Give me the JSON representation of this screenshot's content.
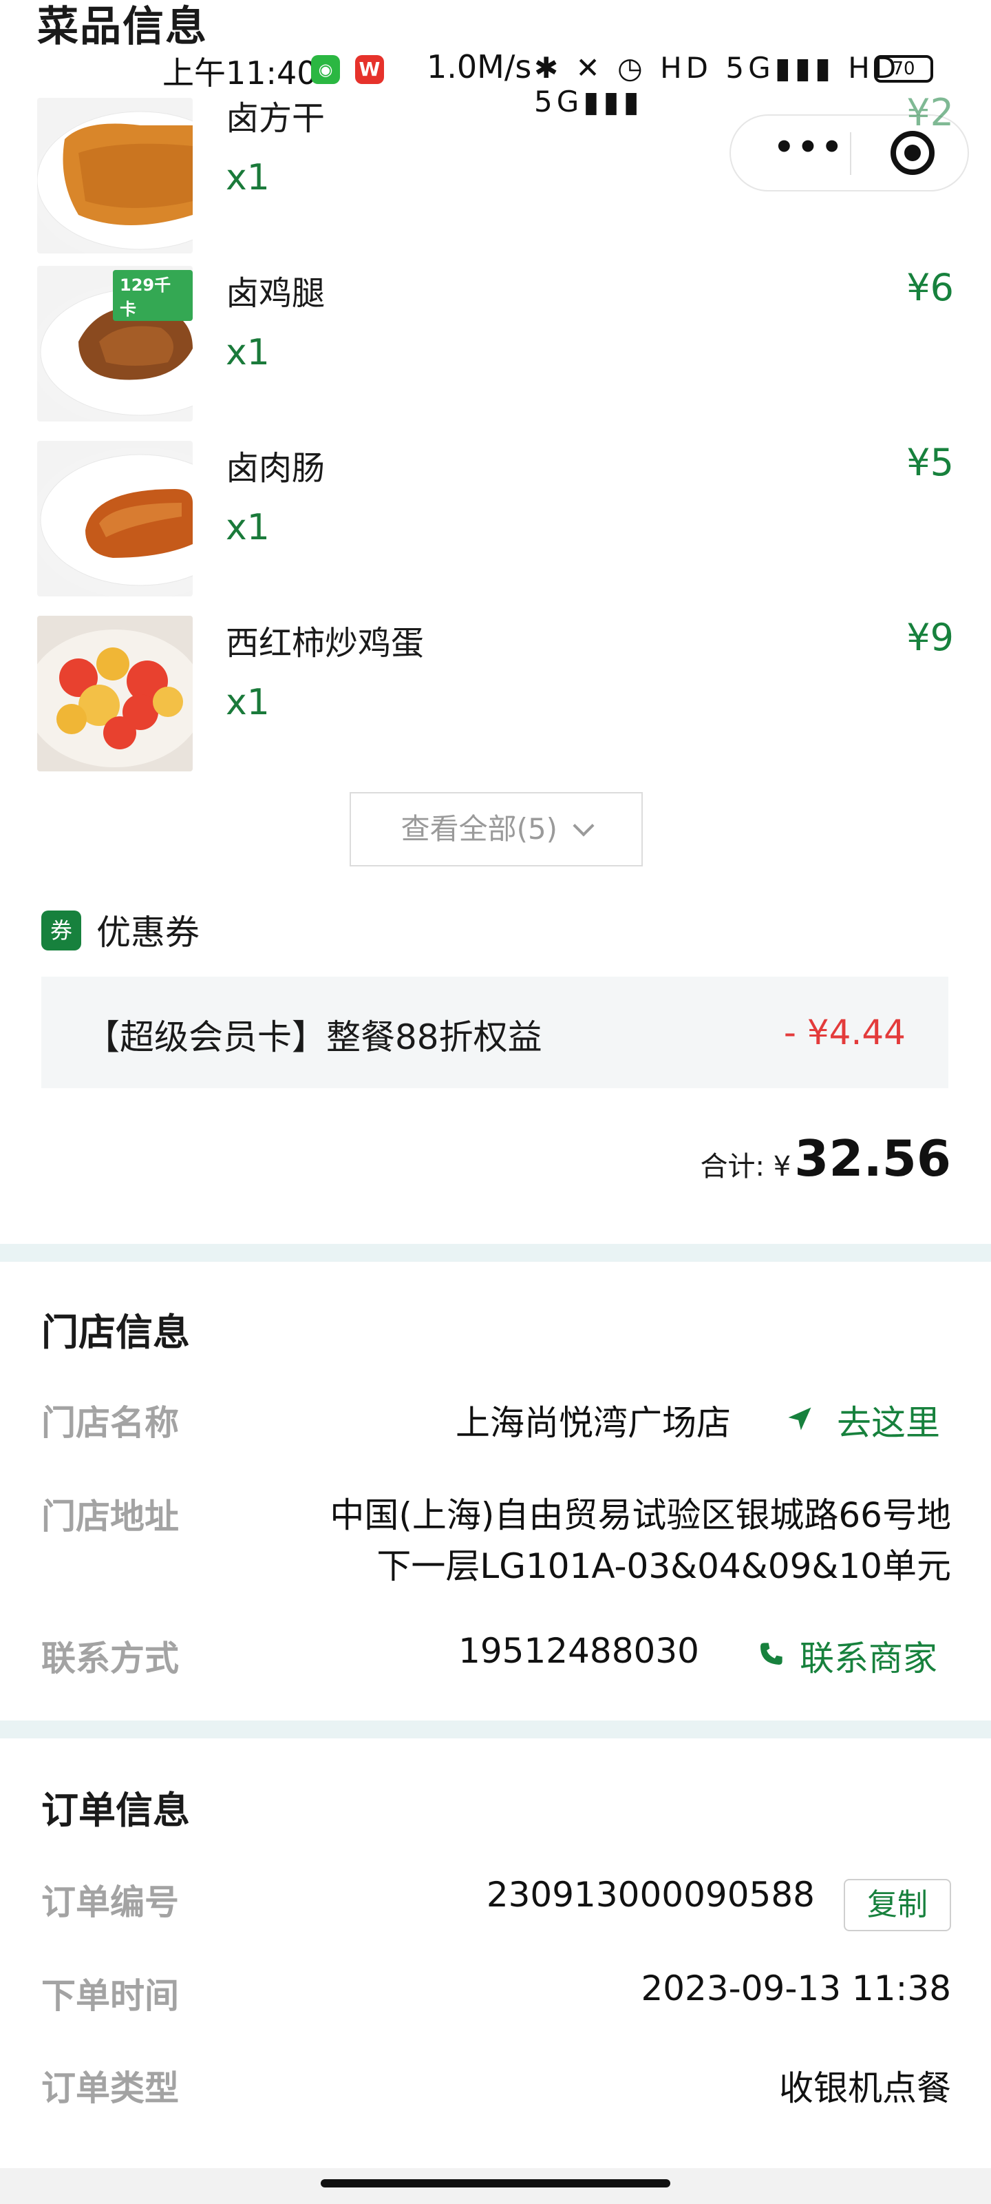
{
  "page": {
    "section_dishes_title": "菜品信息"
  },
  "status_bar": {
    "time": "上午11:40",
    "w_icon_text": "W",
    "net_speed": "1.0M/s",
    "icons_text": "✱ ✕ ◷ HD 5G▮▮▮ HD 5G▮▮▮",
    "battery": "70"
  },
  "capsule": {
    "more_text": "•••"
  },
  "dishes": [
    {
      "name": "卤方干",
      "qty": "x1",
      "price": "¥2",
      "image": "braised-tofu"
    },
    {
      "name": "卤鸡腿",
      "qty": "x1",
      "price": "¥6",
      "image": "braised-chicken-leg",
      "badge": "129千卡"
    },
    {
      "name": "卤肉肠",
      "qty": "x1",
      "price": "¥5",
      "image": "braised-sausage"
    },
    {
      "name": "西红柿炒鸡蛋",
      "qty": "x1",
      "price": "¥9",
      "image": "tomato-egg"
    }
  ],
  "view_all": {
    "label": "查看全部(5)",
    "icon": "chevron-down-icon"
  },
  "coupon": {
    "icon_text": "券",
    "title": "优惠券",
    "name": "【超级会员卡】整餐88折权益",
    "amount": "- ¥4.44"
  },
  "total": {
    "label": "合计: ¥",
    "value": "32.56"
  },
  "store": {
    "title": "门店信息",
    "name_label": "门店名称",
    "name_value": "上海尚悦湾广场店",
    "goto_label": "去这里",
    "address_label": "门店地址",
    "address_line1": "中国(上海)自由贸易试验区银城路66号地",
    "address_line2": "下一层LG101A-03&04&09&10单元",
    "contact_label": "联系方式",
    "contact_value": "19512488030",
    "contact_link": "联系商家"
  },
  "order": {
    "title": "订单信息",
    "id_label": "订单编号",
    "id_value": "230913000090588",
    "copy_label": "复制",
    "time_label": "下单时间",
    "time_value": "2023-09-13 11:38",
    "type_label": "订单类型",
    "type_value": "收银机点餐"
  },
  "colors": {
    "accent_green": "#17813d",
    "discount_red": "#e33b3b",
    "separator": "#e9f3f4"
  }
}
